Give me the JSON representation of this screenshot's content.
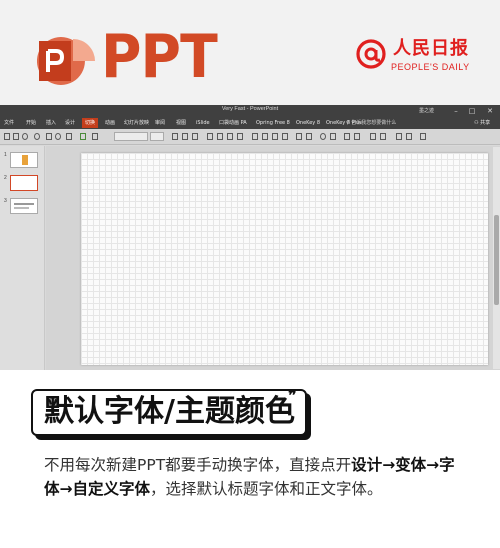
{
  "header": {
    "ppt_text": "PPT",
    "brand_cn": "人民日报",
    "brand_en": "PEOPLE'S DAILY",
    "brand_symbol": "@",
    "accent_color": "#d24a26",
    "brand_color": "#e0201f"
  },
  "window": {
    "title": "Very Fast - PowerPoint",
    "user": "墨之迹",
    "tabs": [
      "文件",
      "开始",
      "插入",
      "设计",
      "切换",
      "动画",
      "幻灯片放映",
      "审阅",
      "视图",
      "iSlide",
      "口袋动画 PA",
      "Opring Free 8",
      "OneKey 8",
      "OneKey 8 Plus"
    ],
    "active_tab_index": 4,
    "tell_me": "告诉我您想要做什么",
    "share": "共享",
    "slide_numbers": [
      "1",
      "2",
      "3"
    ],
    "selected_slide_index": 1,
    "active_tab_color": "#c43e1c"
  },
  "caption": {
    "title": "默认字体/主题颜色",
    "body_parts": [
      {
        "text": "不用每次新建PPT都要手动换字体，直接点开",
        "bold": false
      },
      {
        "text": "设计",
        "bold": true
      },
      {
        "text": "→变体→字体→自定义字体",
        "bold": true
      },
      {
        "text": "，选择默认标题字体和正文字体。",
        "bold": false
      }
    ]
  }
}
